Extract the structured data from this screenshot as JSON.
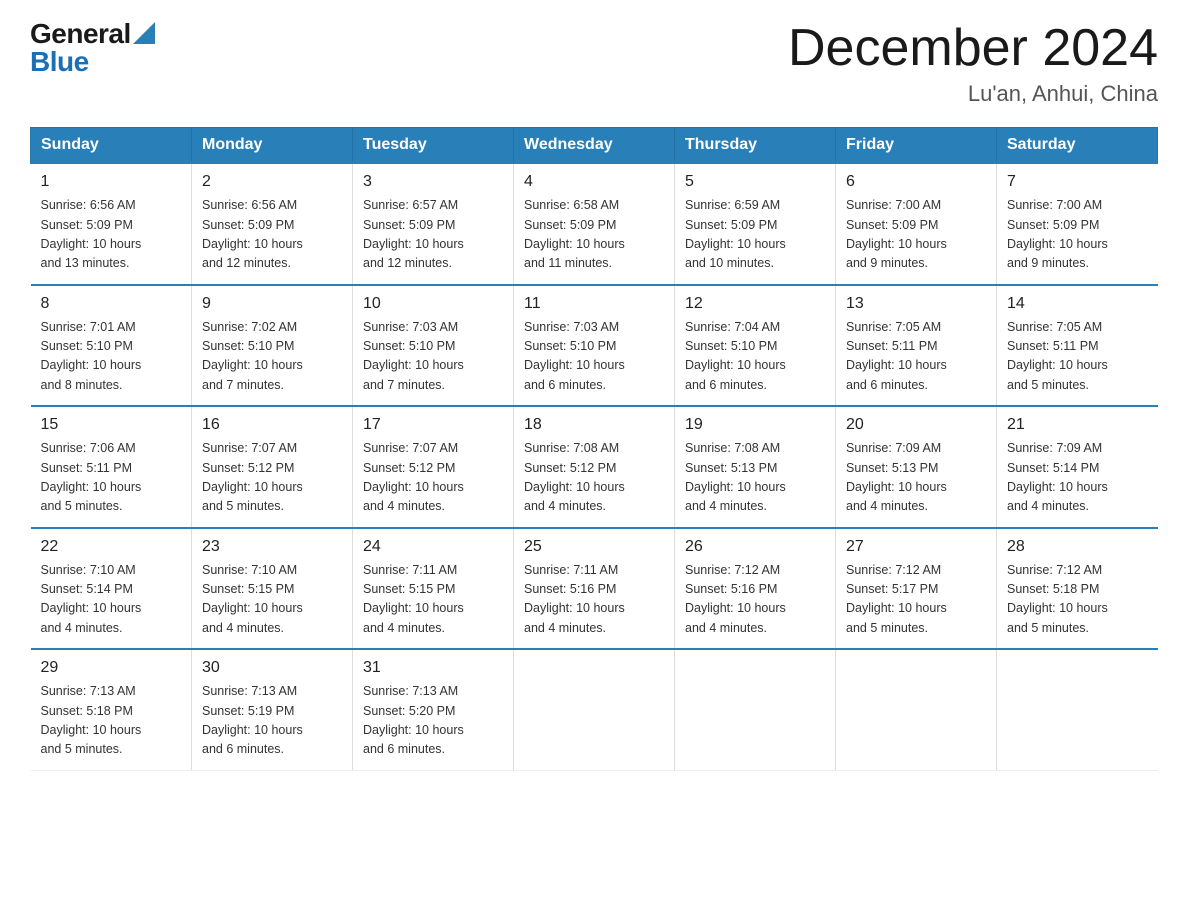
{
  "header": {
    "logo_general": "General",
    "logo_blue": "Blue",
    "title": "December 2024",
    "subtitle": "Lu'an, Anhui, China"
  },
  "days_of_week": [
    "Sunday",
    "Monday",
    "Tuesday",
    "Wednesday",
    "Thursday",
    "Friday",
    "Saturday"
  ],
  "weeks": [
    [
      {
        "day": "1",
        "info": "Sunrise: 6:56 AM\nSunset: 5:09 PM\nDaylight: 10 hours\nand 13 minutes."
      },
      {
        "day": "2",
        "info": "Sunrise: 6:56 AM\nSunset: 5:09 PM\nDaylight: 10 hours\nand 12 minutes."
      },
      {
        "day": "3",
        "info": "Sunrise: 6:57 AM\nSunset: 5:09 PM\nDaylight: 10 hours\nand 12 minutes."
      },
      {
        "day": "4",
        "info": "Sunrise: 6:58 AM\nSunset: 5:09 PM\nDaylight: 10 hours\nand 11 minutes."
      },
      {
        "day": "5",
        "info": "Sunrise: 6:59 AM\nSunset: 5:09 PM\nDaylight: 10 hours\nand 10 minutes."
      },
      {
        "day": "6",
        "info": "Sunrise: 7:00 AM\nSunset: 5:09 PM\nDaylight: 10 hours\nand 9 minutes."
      },
      {
        "day": "7",
        "info": "Sunrise: 7:00 AM\nSunset: 5:09 PM\nDaylight: 10 hours\nand 9 minutes."
      }
    ],
    [
      {
        "day": "8",
        "info": "Sunrise: 7:01 AM\nSunset: 5:10 PM\nDaylight: 10 hours\nand 8 minutes."
      },
      {
        "day": "9",
        "info": "Sunrise: 7:02 AM\nSunset: 5:10 PM\nDaylight: 10 hours\nand 7 minutes."
      },
      {
        "day": "10",
        "info": "Sunrise: 7:03 AM\nSunset: 5:10 PM\nDaylight: 10 hours\nand 7 minutes."
      },
      {
        "day": "11",
        "info": "Sunrise: 7:03 AM\nSunset: 5:10 PM\nDaylight: 10 hours\nand 6 minutes."
      },
      {
        "day": "12",
        "info": "Sunrise: 7:04 AM\nSunset: 5:10 PM\nDaylight: 10 hours\nand 6 minutes."
      },
      {
        "day": "13",
        "info": "Sunrise: 7:05 AM\nSunset: 5:11 PM\nDaylight: 10 hours\nand 6 minutes."
      },
      {
        "day": "14",
        "info": "Sunrise: 7:05 AM\nSunset: 5:11 PM\nDaylight: 10 hours\nand 5 minutes."
      }
    ],
    [
      {
        "day": "15",
        "info": "Sunrise: 7:06 AM\nSunset: 5:11 PM\nDaylight: 10 hours\nand 5 minutes."
      },
      {
        "day": "16",
        "info": "Sunrise: 7:07 AM\nSunset: 5:12 PM\nDaylight: 10 hours\nand 5 minutes."
      },
      {
        "day": "17",
        "info": "Sunrise: 7:07 AM\nSunset: 5:12 PM\nDaylight: 10 hours\nand 4 minutes."
      },
      {
        "day": "18",
        "info": "Sunrise: 7:08 AM\nSunset: 5:12 PM\nDaylight: 10 hours\nand 4 minutes."
      },
      {
        "day": "19",
        "info": "Sunrise: 7:08 AM\nSunset: 5:13 PM\nDaylight: 10 hours\nand 4 minutes."
      },
      {
        "day": "20",
        "info": "Sunrise: 7:09 AM\nSunset: 5:13 PM\nDaylight: 10 hours\nand 4 minutes."
      },
      {
        "day": "21",
        "info": "Sunrise: 7:09 AM\nSunset: 5:14 PM\nDaylight: 10 hours\nand 4 minutes."
      }
    ],
    [
      {
        "day": "22",
        "info": "Sunrise: 7:10 AM\nSunset: 5:14 PM\nDaylight: 10 hours\nand 4 minutes."
      },
      {
        "day": "23",
        "info": "Sunrise: 7:10 AM\nSunset: 5:15 PM\nDaylight: 10 hours\nand 4 minutes."
      },
      {
        "day": "24",
        "info": "Sunrise: 7:11 AM\nSunset: 5:15 PM\nDaylight: 10 hours\nand 4 minutes."
      },
      {
        "day": "25",
        "info": "Sunrise: 7:11 AM\nSunset: 5:16 PM\nDaylight: 10 hours\nand 4 minutes."
      },
      {
        "day": "26",
        "info": "Sunrise: 7:12 AM\nSunset: 5:16 PM\nDaylight: 10 hours\nand 4 minutes."
      },
      {
        "day": "27",
        "info": "Sunrise: 7:12 AM\nSunset: 5:17 PM\nDaylight: 10 hours\nand 5 minutes."
      },
      {
        "day": "28",
        "info": "Sunrise: 7:12 AM\nSunset: 5:18 PM\nDaylight: 10 hours\nand 5 minutes."
      }
    ],
    [
      {
        "day": "29",
        "info": "Sunrise: 7:13 AM\nSunset: 5:18 PM\nDaylight: 10 hours\nand 5 minutes."
      },
      {
        "day": "30",
        "info": "Sunrise: 7:13 AM\nSunset: 5:19 PM\nDaylight: 10 hours\nand 6 minutes."
      },
      {
        "day": "31",
        "info": "Sunrise: 7:13 AM\nSunset: 5:20 PM\nDaylight: 10 hours\nand 6 minutes."
      },
      null,
      null,
      null,
      null
    ]
  ],
  "colors": {
    "header_bg": "#2980b9",
    "accent": "#1a6fb5"
  }
}
